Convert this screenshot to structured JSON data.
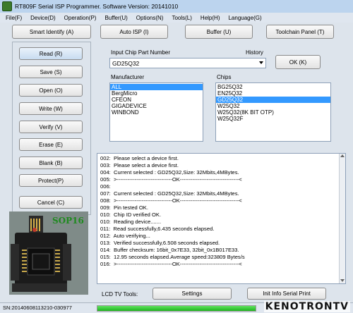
{
  "window": {
    "title": "RT809F Serial ISP Programmer. Software Version: 20141010"
  },
  "menu": [
    "File(F)",
    "Device(D)",
    "Operation(P)",
    "Buffer(U)",
    "Options(N)",
    "Tools(L)",
    "Help(H)",
    "Language(G)"
  ],
  "toolbar": {
    "smart_identify": "Smart Identify (A)",
    "auto_isp": "Auto ISP (I)",
    "buffer": "Buffer (U)",
    "toolchain": "Toolchain Panel (T)"
  },
  "actions": [
    "Read (R)",
    "Save (S)",
    "Open (O)",
    "Write  (W)",
    "Verify (V)",
    "Erase (E)",
    "Blank (B)",
    "Protect(P)"
  ],
  "cancel_label": "Cancel (C)",
  "chip_select": {
    "input_label": "Input Chip Part Number",
    "history_label": "History",
    "input_value": "GD25Q32",
    "ok_label": "OK (K)",
    "manufacturer_label": "Manufacturer",
    "manufacturers": [
      "ALL",
      "BergMicro",
      "CFEON",
      "GIGADEVICE",
      "WINBOND"
    ],
    "manufacturer_selected": 0,
    "chips_label": "Chips",
    "chips": [
      "BG25Q32",
      "EN25Q32",
      "GD25Q32",
      "W25Q32",
      "W25Q32(8K BIT OTP)",
      "W25Q32F"
    ],
    "chip_selected": 2
  },
  "log": [
    "002:  Please select a device first.",
    "003:  Please select a device first.",
    "004:  Current selected : GD25Q32,Size: 32Mbits,4MBytes.",
    "005:  >-------------------------------OK---------------------------------<",
    "006:  ",
    "007:  Current selected : GD25Q32,Size: 32Mbits,4MBytes.",
    "008:  >-------------------------------OK---------------------------------<",
    "009:  Pin tested OK.",
    "010:  Chip ID verified OK.",
    "010:  Reading device.......",
    "011:  Read successfully,6.435 seconds elapsed.",
    "012:  Auto verifying...",
    "013:  Verified successfully,6.508 seconds elapsed.",
    "014:  Buffer checksum: 16bit_0x7E33, 32bit_0x1B017E33.",
    "015:  12.95 seconds elapsed.Average speed:323809 Bytes/s",
    "016:  >-------------------------------OK---------------------------------<"
  ],
  "bottom": {
    "lcd_label": "LCD TV Tools:",
    "settings_label": "Settings",
    "init_label": "Init Info Serial Print"
  },
  "chip_image_label": "SOP16",
  "status": {
    "serial": "SN:20140608113210-030977",
    "progress_fraction": 1.0
  },
  "watermark": "KENOTRONTV"
}
